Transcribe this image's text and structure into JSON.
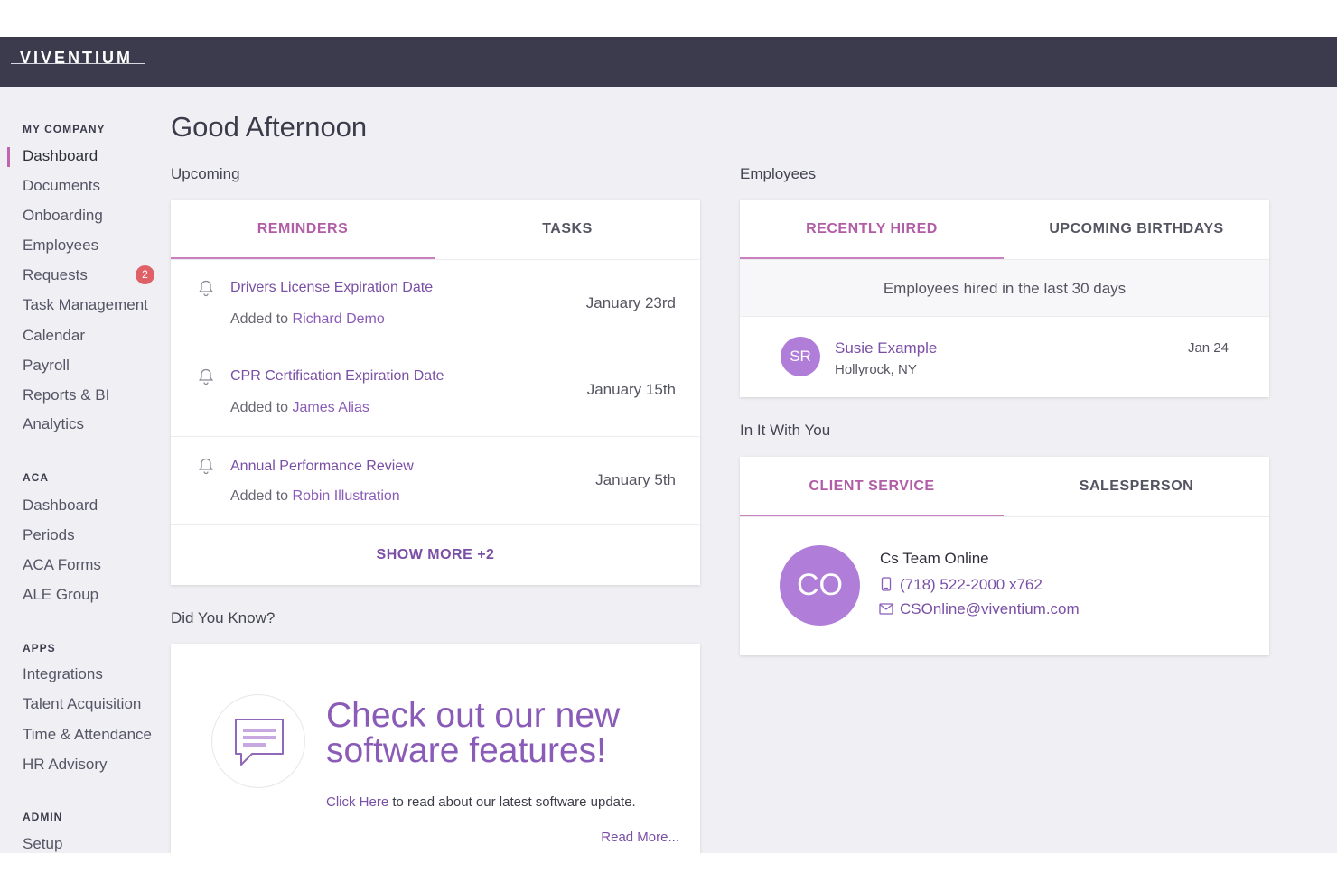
{
  "app": {
    "logo": "VIVENTIUM"
  },
  "sidebar": {
    "sections": [
      {
        "title": "MY COMPANY",
        "items": [
          "Dashboard",
          "Documents",
          "Onboarding",
          "Employees",
          "Requests",
          "Task Management",
          "Calendar",
          "Payroll",
          "Reports & BI",
          "Analytics"
        ]
      },
      {
        "title": "ACA",
        "items": [
          "Dashboard",
          "Periods",
          "ACA Forms",
          "ALE Group"
        ]
      },
      {
        "title": "APPS",
        "items": [
          "Integrations",
          "Talent Acquisition",
          "Time & Attendance",
          "HR Advisory"
        ]
      },
      {
        "title": "ADMIN",
        "items": [
          "Setup"
        ]
      }
    ],
    "requests_badge": "2"
  },
  "main": {
    "greeting": "Good Afternoon",
    "upcoming": {
      "label": "Upcoming",
      "tabs": [
        "REMINDERS",
        "TASKS"
      ],
      "reminders": [
        {
          "title": "Drivers License Expiration Date",
          "added_prefix": "Added to",
          "person": "Richard Demo",
          "date": "January 23rd"
        },
        {
          "title": "CPR Certification Expiration Date",
          "added_prefix": "Added to",
          "person": "James Alias",
          "date": "January 15th"
        },
        {
          "title": "Annual Performance Review",
          "added_prefix": "Added to",
          "person": "Robin Illustration",
          "date": "January 5th"
        }
      ],
      "show_more": "SHOW MORE +2"
    },
    "did_you_know": {
      "label": "Did You Know?",
      "headline_1": "Check out our new",
      "headline_2": "software features!",
      "link": "Click Here",
      "text": "to read about our latest software update.",
      "read_more": "Read More..."
    },
    "employees": {
      "label": "Employees",
      "tabs": [
        "RECENTLY HIRED",
        "UPCOMING BIRTHDAYS"
      ],
      "subtitle": "Employees hired in the last 30 days",
      "hires": [
        {
          "initials": "SR",
          "name": "Susie Example",
          "location": "Hollyrock, NY",
          "date": "Jan 24"
        }
      ]
    },
    "in_it": {
      "label": "In It With You",
      "tabs": [
        "CLIENT SERVICE",
        "SALESPERSON"
      ],
      "contact": {
        "initials": "CO",
        "name": "Cs Team Online",
        "phone": "(718) 522-2000 x762",
        "email": "CSOnline@viventium.com"
      }
    }
  },
  "colors": {
    "accent": "#b25ea6",
    "link": "#7a4fa6",
    "avatar": "#b07ed8",
    "topbar": "#3b3b4d",
    "badge": "#e06068"
  }
}
